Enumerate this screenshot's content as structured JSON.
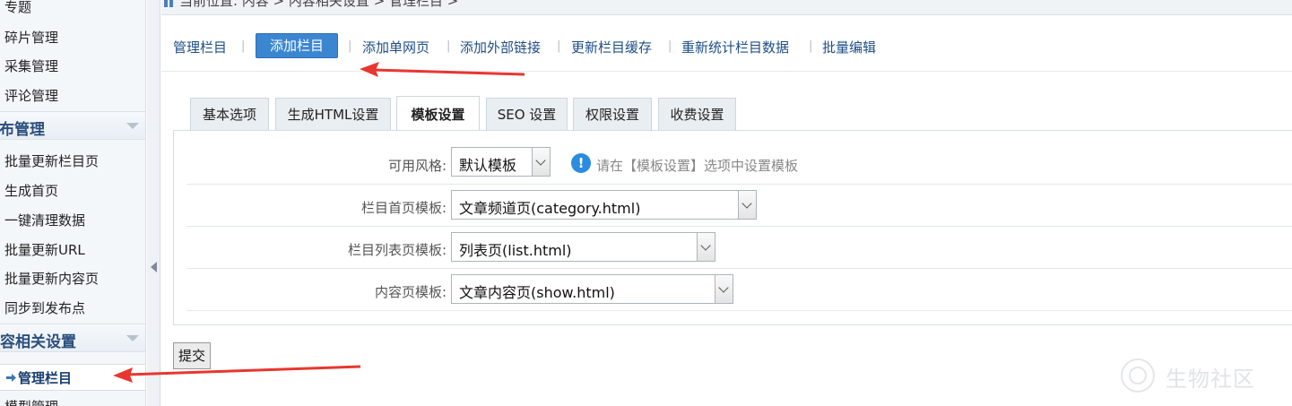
{
  "breadcrumb": {
    "text": "当前位置: 内容 > 内容相关设置 > 管理栏目 >"
  },
  "sidebar": {
    "items_top": [
      "专题",
      "碎片管理",
      "采集管理",
      "评论管理"
    ],
    "group_publish": "发布管理",
    "items_publish": [
      "批量更新栏目页",
      "生成首页",
      "一键清理数据",
      "批量更新URL",
      "批量更新内容页",
      "同步到发布点"
    ],
    "group_content": "内容相关设置",
    "active_item": "管理栏目",
    "cut_item": "模型管理"
  },
  "subnav": {
    "links": [
      "管理栏目",
      "添加栏目",
      "添加单网页",
      "添加外部链接",
      "更新栏目缓存",
      "重新统计栏目数据",
      "批量编辑"
    ],
    "active": "添加栏目"
  },
  "tabs": [
    "基本选项",
    "生成HTML设置",
    "模板设置",
    "SEO 设置",
    "权限设置",
    "收费设置"
  ],
  "active_tab": "模板设置",
  "form": {
    "style": {
      "label": "可用风格:",
      "value": "默认模板",
      "tip": "请在【模板设置】选项中设置模板"
    },
    "category_template": {
      "label": "栏目首页模板:",
      "value": "文章频道页(category.html)"
    },
    "list_template": {
      "label": "栏目列表页模板:",
      "value": "列表页(list.html)"
    },
    "show_template": {
      "label": "内容页模板:",
      "value": "文章内容页(show.html)"
    }
  },
  "submit_label": "提交",
  "watermark": "生物社区",
  "colors": {
    "accent": "#3b86d1",
    "link": "#1d4e86",
    "annotation": "#e8372f"
  },
  "icons": {
    "home": "home-icon",
    "tip": "info-icon",
    "active_item": "arrow-right-icon"
  }
}
